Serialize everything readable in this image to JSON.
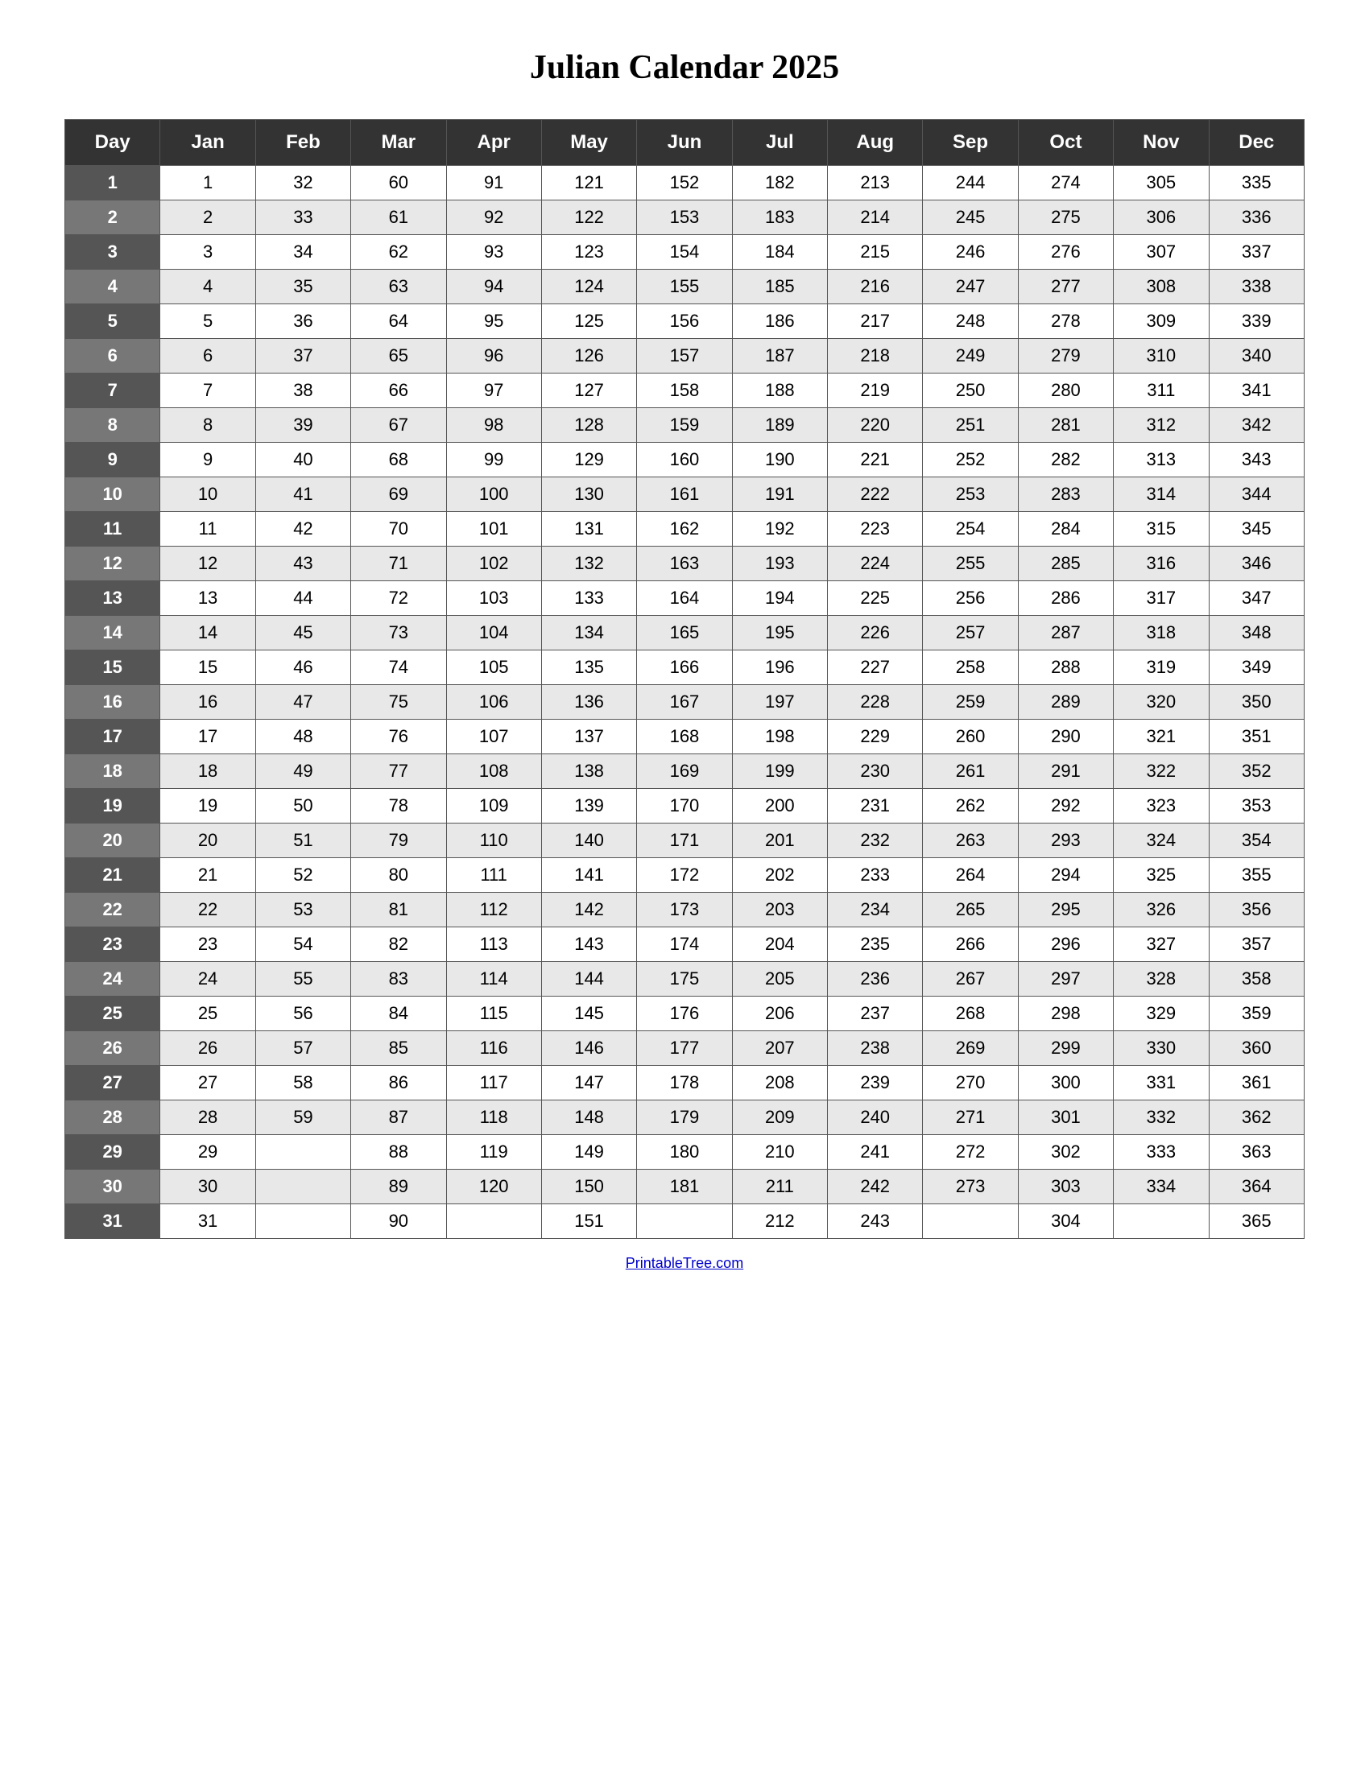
{
  "title": "Julian Calendar 2025",
  "footer": "PrintableTree.com",
  "headers": [
    "Day",
    "Jan",
    "Feb",
    "Mar",
    "Apr",
    "May",
    "Jun",
    "Jul",
    "Aug",
    "Sep",
    "Oct",
    "Nov",
    "Dec"
  ],
  "rows": [
    {
      "day": 1,
      "jan": 1,
      "feb": 32,
      "mar": 60,
      "apr": 91,
      "may": 121,
      "jun": 152,
      "jul": 182,
      "aug": 213,
      "sep": 244,
      "oct": 274,
      "nov": 305,
      "dec": 335
    },
    {
      "day": 2,
      "jan": 2,
      "feb": 33,
      "mar": 61,
      "apr": 92,
      "may": 122,
      "jun": 153,
      "jul": 183,
      "aug": 214,
      "sep": 245,
      "oct": 275,
      "nov": 306,
      "dec": 336
    },
    {
      "day": 3,
      "jan": 3,
      "feb": 34,
      "mar": 62,
      "apr": 93,
      "may": 123,
      "jun": 154,
      "jul": 184,
      "aug": 215,
      "sep": 246,
      "oct": 276,
      "nov": 307,
      "dec": 337
    },
    {
      "day": 4,
      "jan": 4,
      "feb": 35,
      "mar": 63,
      "apr": 94,
      "may": 124,
      "jun": 155,
      "jul": 185,
      "aug": 216,
      "sep": 247,
      "oct": 277,
      "nov": 308,
      "dec": 338
    },
    {
      "day": 5,
      "jan": 5,
      "feb": 36,
      "mar": 64,
      "apr": 95,
      "may": 125,
      "jun": 156,
      "jul": 186,
      "aug": 217,
      "sep": 248,
      "oct": 278,
      "nov": 309,
      "dec": 339
    },
    {
      "day": 6,
      "jan": 6,
      "feb": 37,
      "mar": 65,
      "apr": 96,
      "may": 126,
      "jun": 157,
      "jul": 187,
      "aug": 218,
      "sep": 249,
      "oct": 279,
      "nov": 310,
      "dec": 340
    },
    {
      "day": 7,
      "jan": 7,
      "feb": 38,
      "mar": 66,
      "apr": 97,
      "may": 127,
      "jun": 158,
      "jul": 188,
      "aug": 219,
      "sep": 250,
      "oct": 280,
      "nov": 311,
      "dec": 341
    },
    {
      "day": 8,
      "jan": 8,
      "feb": 39,
      "mar": 67,
      "apr": 98,
      "may": 128,
      "jun": 159,
      "jul": 189,
      "aug": 220,
      "sep": 251,
      "oct": 281,
      "nov": 312,
      "dec": 342
    },
    {
      "day": 9,
      "jan": 9,
      "feb": 40,
      "mar": 68,
      "apr": 99,
      "may": 129,
      "jun": 160,
      "jul": 190,
      "aug": 221,
      "sep": 252,
      "oct": 282,
      "nov": 313,
      "dec": 343
    },
    {
      "day": 10,
      "jan": 10,
      "feb": 41,
      "mar": 69,
      "apr": 100,
      "may": 130,
      "jun": 161,
      "jul": 191,
      "aug": 222,
      "sep": 253,
      "oct": 283,
      "nov": 314,
      "dec": 344
    },
    {
      "day": 11,
      "jan": 11,
      "feb": 42,
      "mar": 70,
      "apr": 101,
      "may": 131,
      "jun": 162,
      "jul": 192,
      "aug": 223,
      "sep": 254,
      "oct": 284,
      "nov": 315,
      "dec": 345
    },
    {
      "day": 12,
      "jan": 12,
      "feb": 43,
      "mar": 71,
      "apr": 102,
      "may": 132,
      "jun": 163,
      "jul": 193,
      "aug": 224,
      "sep": 255,
      "oct": 285,
      "nov": 316,
      "dec": 346
    },
    {
      "day": 13,
      "jan": 13,
      "feb": 44,
      "mar": 72,
      "apr": 103,
      "may": 133,
      "jun": 164,
      "jul": 194,
      "aug": 225,
      "sep": 256,
      "oct": 286,
      "nov": 317,
      "dec": 347
    },
    {
      "day": 14,
      "jan": 14,
      "feb": 45,
      "mar": 73,
      "apr": 104,
      "may": 134,
      "jun": 165,
      "jul": 195,
      "aug": 226,
      "sep": 257,
      "oct": 287,
      "nov": 318,
      "dec": 348
    },
    {
      "day": 15,
      "jan": 15,
      "feb": 46,
      "mar": 74,
      "apr": 105,
      "may": 135,
      "jun": 166,
      "jul": 196,
      "aug": 227,
      "sep": 258,
      "oct": 288,
      "nov": 319,
      "dec": 349
    },
    {
      "day": 16,
      "jan": 16,
      "feb": 47,
      "mar": 75,
      "apr": 106,
      "may": 136,
      "jun": 167,
      "jul": 197,
      "aug": 228,
      "sep": 259,
      "oct": 289,
      "nov": 320,
      "dec": 350
    },
    {
      "day": 17,
      "jan": 17,
      "feb": 48,
      "mar": 76,
      "apr": 107,
      "may": 137,
      "jun": 168,
      "jul": 198,
      "aug": 229,
      "sep": 260,
      "oct": 290,
      "nov": 321,
      "dec": 351
    },
    {
      "day": 18,
      "jan": 18,
      "feb": 49,
      "mar": 77,
      "apr": 108,
      "may": 138,
      "jun": 169,
      "jul": 199,
      "aug": 230,
      "sep": 261,
      "oct": 291,
      "nov": 322,
      "dec": 352
    },
    {
      "day": 19,
      "jan": 19,
      "feb": 50,
      "mar": 78,
      "apr": 109,
      "may": 139,
      "jun": 170,
      "jul": 200,
      "aug": 231,
      "sep": 262,
      "oct": 292,
      "nov": 323,
      "dec": 353
    },
    {
      "day": 20,
      "jan": 20,
      "feb": 51,
      "mar": 79,
      "apr": 110,
      "may": 140,
      "jun": 171,
      "jul": 201,
      "aug": 232,
      "sep": 263,
      "oct": 293,
      "nov": 324,
      "dec": 354
    },
    {
      "day": 21,
      "jan": 21,
      "feb": 52,
      "mar": 80,
      "apr": 111,
      "may": 141,
      "jun": 172,
      "jul": 202,
      "aug": 233,
      "sep": 264,
      "oct": 294,
      "nov": 325,
      "dec": 355
    },
    {
      "day": 22,
      "jan": 22,
      "feb": 53,
      "mar": 81,
      "apr": 112,
      "may": 142,
      "jun": 173,
      "jul": 203,
      "aug": 234,
      "sep": 265,
      "oct": 295,
      "nov": 326,
      "dec": 356
    },
    {
      "day": 23,
      "jan": 23,
      "feb": 54,
      "mar": 82,
      "apr": 113,
      "may": 143,
      "jun": 174,
      "jul": 204,
      "aug": 235,
      "sep": 266,
      "oct": 296,
      "nov": 327,
      "dec": 357
    },
    {
      "day": 24,
      "jan": 24,
      "feb": 55,
      "mar": 83,
      "apr": 114,
      "may": 144,
      "jun": 175,
      "jul": 205,
      "aug": 236,
      "sep": 267,
      "oct": 297,
      "nov": 328,
      "dec": 358
    },
    {
      "day": 25,
      "jan": 25,
      "feb": 56,
      "mar": 84,
      "apr": 115,
      "may": 145,
      "jun": 176,
      "jul": 206,
      "aug": 237,
      "sep": 268,
      "oct": 298,
      "nov": 329,
      "dec": 359
    },
    {
      "day": 26,
      "jan": 26,
      "feb": 57,
      "mar": 85,
      "apr": 116,
      "may": 146,
      "jun": 177,
      "jul": 207,
      "aug": 238,
      "sep": 269,
      "oct": 299,
      "nov": 330,
      "dec": 360
    },
    {
      "day": 27,
      "jan": 27,
      "feb": 58,
      "mar": 86,
      "apr": 117,
      "may": 147,
      "jun": 178,
      "jul": 208,
      "aug": 239,
      "sep": 270,
      "oct": 300,
      "nov": 331,
      "dec": 361
    },
    {
      "day": 28,
      "jan": 28,
      "feb": 59,
      "mar": 87,
      "apr": 118,
      "may": 148,
      "jun": 179,
      "jul": 209,
      "aug": 240,
      "sep": 271,
      "oct": 301,
      "nov": 332,
      "dec": 362
    },
    {
      "day": 29,
      "jan": 29,
      "feb": "",
      "mar": 88,
      "apr": 119,
      "may": 149,
      "jun": 180,
      "jul": 210,
      "aug": 241,
      "sep": 272,
      "oct": 302,
      "nov": 333,
      "dec": 363
    },
    {
      "day": 30,
      "jan": 30,
      "feb": "",
      "mar": 89,
      "apr": 120,
      "may": 150,
      "jun": 181,
      "jul": 211,
      "aug": 242,
      "sep": 273,
      "oct": 303,
      "nov": 334,
      "dec": 364
    },
    {
      "day": 31,
      "jan": 31,
      "feb": "",
      "mar": 90,
      "apr": "",
      "may": 151,
      "jun": "",
      "jul": 212,
      "aug": 243,
      "sep": "",
      "oct": 304,
      "nov": "",
      "dec": 365
    }
  ]
}
